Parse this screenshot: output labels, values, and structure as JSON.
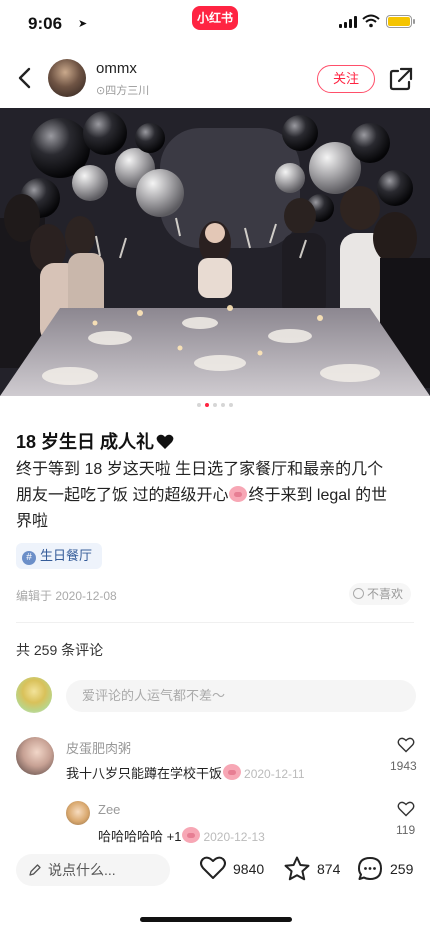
{
  "status_bar": {
    "time": "9:06",
    "app_badge": "小红书",
    "battery_color": "#f5c400"
  },
  "author": {
    "name": "ommx",
    "location": "四方三川",
    "follow_label": "关注"
  },
  "carousel": {
    "current": 2,
    "total": 5
  },
  "post": {
    "title": "18 岁生日  成人礼",
    "title_emoji": "black-heart-icon",
    "body_line1": "终于等到 18 岁这天啦  生日选了家餐厅和最亲的几个",
    "body_line2a": "朋友一起吃了饭   过的超级开心",
    "body_line2b": "终于来到 legal 的世",
    "body_line3": "界啦",
    "tag": "生日餐厅",
    "edit_date": "编辑于  2020-12-08",
    "dislike_label": "不喜欢"
  },
  "comments_section": {
    "count_label": "共 259 条评论",
    "input_placeholder": "爱评论的人运气都不差～",
    "items": [
      {
        "user": "皮蛋肥肉粥",
        "text": "我十八岁只能蹲在学校干饭",
        "date": "2020-12-11",
        "likes": "1943"
      },
      {
        "user": "Zee",
        "text": "哈哈哈哈哈 +1",
        "date": "2020-12-13",
        "likes": "119"
      }
    ]
  },
  "bottom_bar": {
    "say_placeholder": "说点什么...",
    "likes": "9840",
    "favorites": "874",
    "comments": "259"
  },
  "colors": {
    "brand_red": "#ff2442",
    "tag_blue": "#355c99"
  }
}
